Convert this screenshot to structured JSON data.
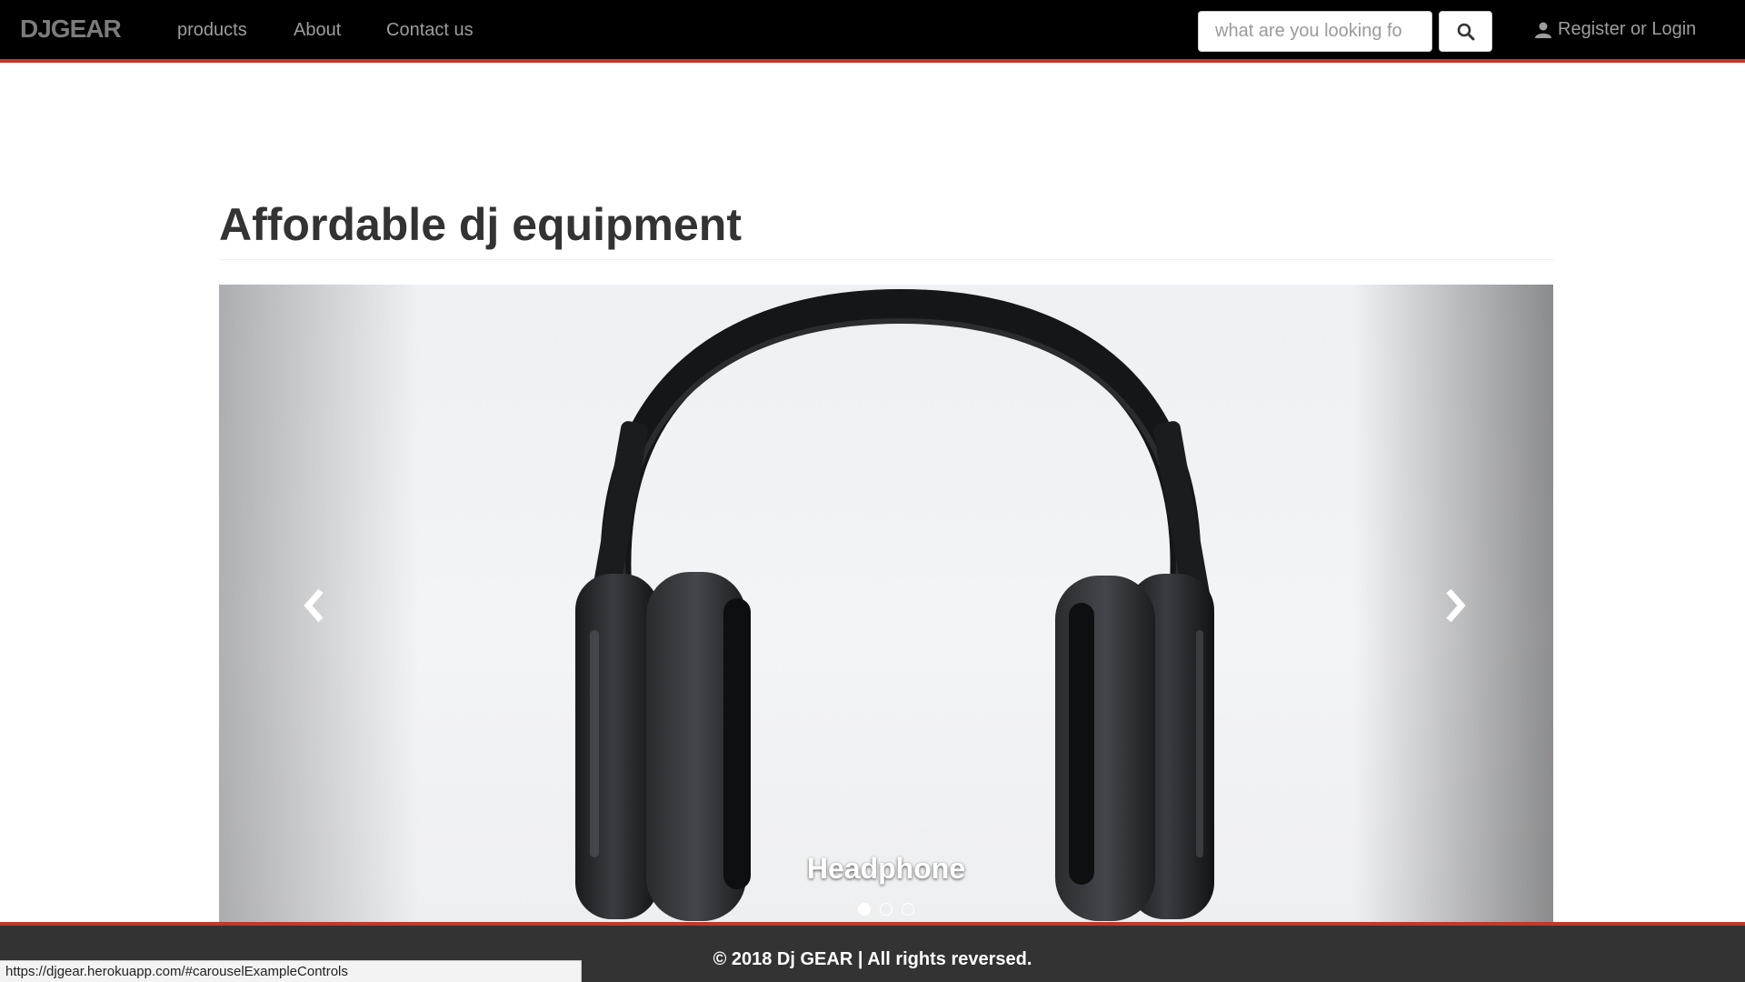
{
  "navbar": {
    "brand": "DJGEAR",
    "links": [
      "products",
      "About",
      "Contact us"
    ],
    "search_placeholder": "what are you looking fo",
    "search_icon": "search-icon",
    "login_label": "Register or Login",
    "user_icon": "user-icon"
  },
  "main": {
    "title": "Affordable dj equipment"
  },
  "carousel": {
    "caption": "Headphone",
    "slides_count": 3,
    "active_index": 0
  },
  "footer": {
    "text": "© 2018 Dj GEAR | All rights reversed."
  },
  "status_bar": {
    "url": "https://djgear.herokuapp.com/#carouselExampleControls"
  },
  "colors": {
    "navbar_bg": "#000000",
    "accent": "#c0392b",
    "footer_bg": "#333333"
  }
}
